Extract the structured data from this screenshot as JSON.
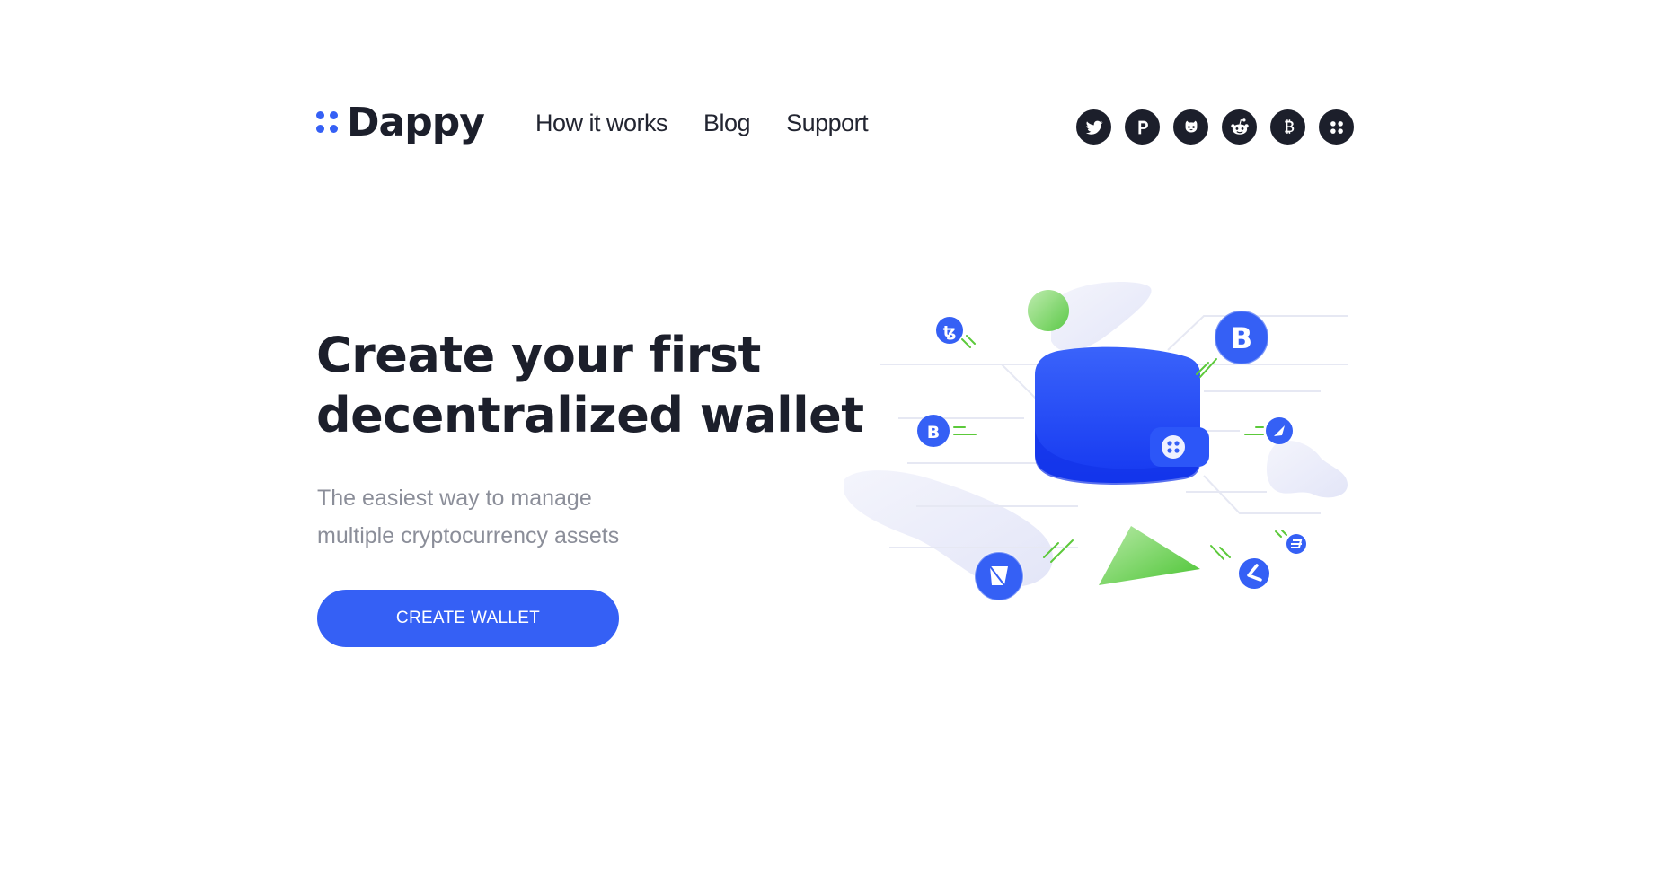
{
  "brand": {
    "name": "Dappy",
    "accent_color": "#3560f5",
    "text_color": "#1c1f2b"
  },
  "nav": {
    "items": [
      {
        "label": "How it works"
      },
      {
        "label": "Blog"
      },
      {
        "label": "Support"
      }
    ]
  },
  "social": {
    "icons": [
      "twitter-icon",
      "producthunt-icon",
      "github-icon",
      "reddit-icon",
      "bitcoin-icon",
      "dappy-icon"
    ]
  },
  "hero": {
    "title_line_1": "Create your first",
    "title_line_2": "decentralized wallet",
    "subtitle_line_1": "The easiest way to manage",
    "subtitle_line_2": "multiple cryptocurrency assets",
    "cta_label": "CREATE WALLET"
  },
  "illustration": {
    "main": "wallet-icon",
    "coins": [
      "bitcoin-coin-icon",
      "tezos-coin-icon",
      "bitcoin-small-coin-icon",
      "icon-coin-icon",
      "ethereum-coin-icon",
      "litecoin-coin-icon",
      "dash-coin-icon"
    ],
    "green_color": "#5cc93a"
  }
}
